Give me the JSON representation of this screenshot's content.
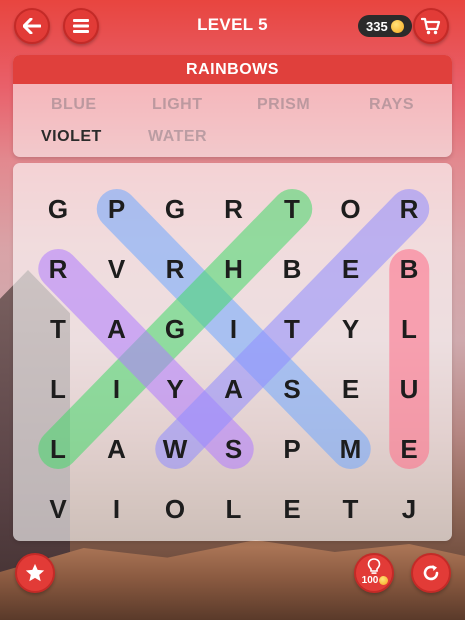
{
  "header": {
    "level_label": "LEVEL 5",
    "coins": "335"
  },
  "words_panel": {
    "category": "RAINBOWS",
    "words": [
      {
        "text": "BLUE",
        "found": false
      },
      {
        "text": "LIGHT",
        "found": false
      },
      {
        "text": "PRISM",
        "found": false
      },
      {
        "text": "RAYS",
        "found": false
      },
      {
        "text": "VIOLET",
        "found": true
      },
      {
        "text": "WATER",
        "found": false
      }
    ]
  },
  "grid": {
    "rows": [
      [
        "G",
        "P",
        "G",
        "R",
        "T",
        "O",
        "R"
      ],
      [
        "R",
        "V",
        "R",
        "H",
        "B",
        "E",
        "B"
      ],
      [
        "T",
        "A",
        "G",
        "I",
        "T",
        "Y",
        "L"
      ],
      [
        "L",
        "I",
        "Y",
        "A",
        "S",
        "E",
        "U"
      ],
      [
        "L",
        "A",
        "W",
        "S",
        "P",
        "M",
        "E"
      ],
      [
        "V",
        "I",
        "O",
        "L",
        "E",
        "T",
        "J"
      ]
    ],
    "highlights": [
      {
        "word": "PRISM",
        "color": "#6fa8ff",
        "from": [
          0,
          1
        ],
        "to": [
          4,
          5
        ]
      },
      {
        "word": "LIGHT",
        "color": "#44d96a",
        "from": [
          4,
          0
        ],
        "to": [
          0,
          4
        ]
      },
      {
        "word": "RAYS",
        "color": "#b07cff",
        "from": [
          1,
          0
        ],
        "to": [
          4,
          3
        ]
      },
      {
        "word": "WATER",
        "color": "#8f8cff",
        "from": [
          4,
          2
        ],
        "to": [
          0,
          6
        ]
      },
      {
        "word": "BLUE",
        "color": "#ff6b87",
        "from": [
          1,
          6
        ],
        "to": [
          4,
          6
        ]
      }
    ]
  },
  "footer": {
    "hint_cost": "100"
  }
}
